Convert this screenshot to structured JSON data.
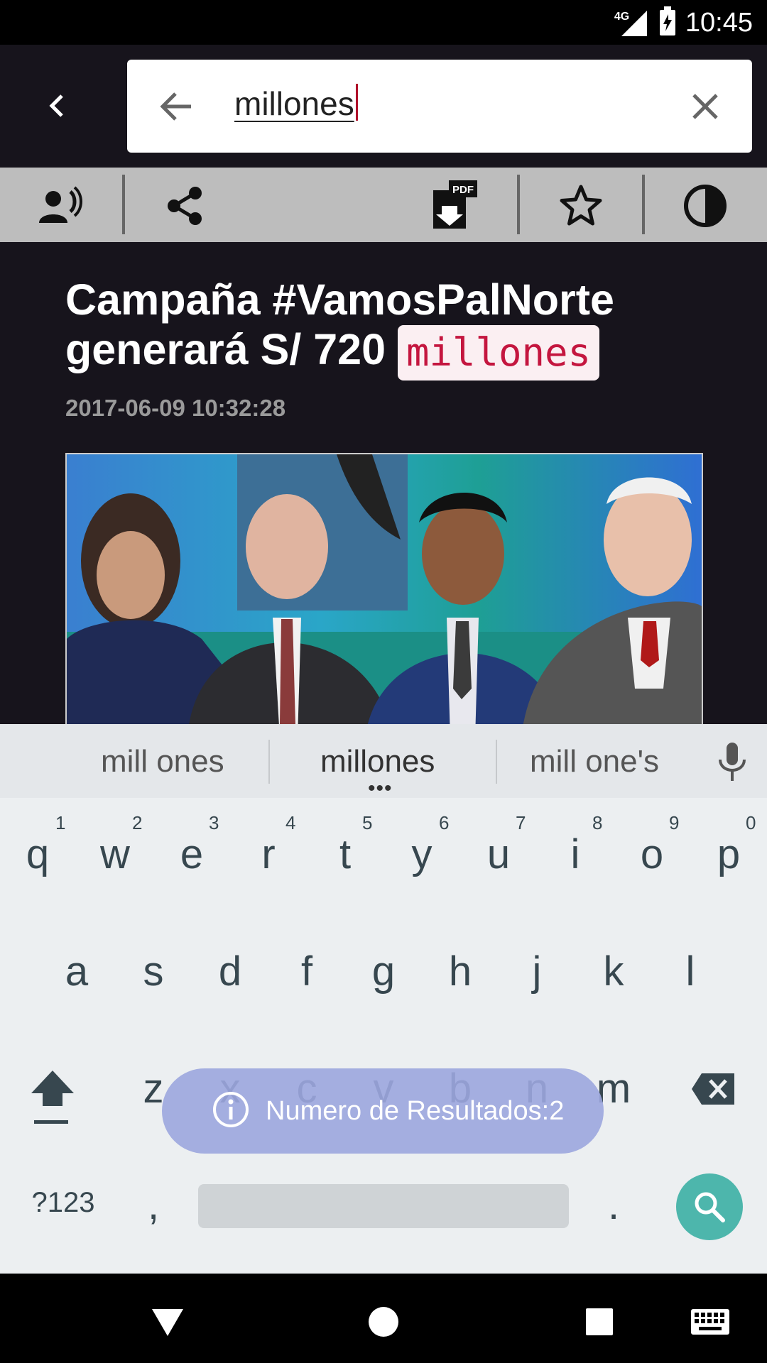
{
  "status_bar": {
    "network": "4G",
    "time": "10:45"
  },
  "search": {
    "query": "millones"
  },
  "article": {
    "title_part1": "Campaña #VamosPalNorte",
    "title_part2": "generará S/ 720",
    "title_highlight": "millones",
    "date": "2017-06-09 10:32:28"
  },
  "keyboard": {
    "suggestions": [
      "mill ones",
      "millones",
      "mill one's"
    ],
    "row1": [
      "q",
      "w",
      "e",
      "r",
      "t",
      "y",
      "u",
      "i",
      "o",
      "p"
    ],
    "row1_hints": [
      "1",
      "2",
      "3",
      "4",
      "5",
      "6",
      "7",
      "8",
      "9",
      "0"
    ],
    "row2": [
      "a",
      "s",
      "d",
      "f",
      "g",
      "h",
      "j",
      "k",
      "l"
    ],
    "row3": [
      "z",
      "x",
      "c",
      "v",
      "b",
      "n",
      "m"
    ],
    "symbols_label": "?123",
    "comma": ",",
    "period": "."
  },
  "toast": {
    "text": "Numero de Resultados:2"
  },
  "icons": [
    "signal-icon",
    "battery-charging-icon",
    "back-icon",
    "arrow-left-icon",
    "close-icon",
    "text-to-speech-icon",
    "share-icon",
    "pdf-download-icon",
    "star-icon",
    "contrast-icon",
    "microphone-icon",
    "shift-icon",
    "backspace-icon",
    "search-icon",
    "info-icon",
    "nav-back-icon",
    "nav-home-icon",
    "nav-recents-icon",
    "keyboard-icon"
  ]
}
